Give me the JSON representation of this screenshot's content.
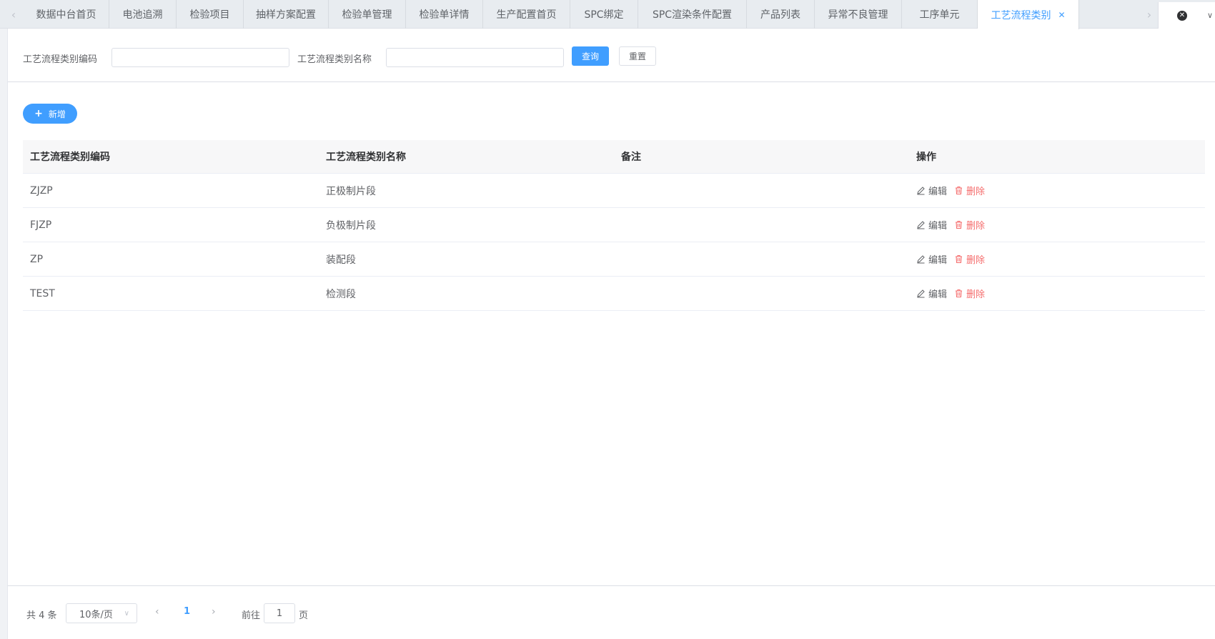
{
  "tabs": [
    {
      "label": "数据中台首页",
      "active": false
    },
    {
      "label": "电池追溯",
      "active": false
    },
    {
      "label": "检验项目",
      "active": false
    },
    {
      "label": "抽样方案配置",
      "active": false
    },
    {
      "label": "检验单管理",
      "active": false
    },
    {
      "label": "检验单详情",
      "active": false
    },
    {
      "label": "生产配置首页",
      "active": false
    },
    {
      "label": "SPC绑定",
      "active": false
    },
    {
      "label": "SPC渲染条件配置",
      "active": false
    },
    {
      "label": "产品列表",
      "active": false
    },
    {
      "label": "异常不良管理",
      "active": false
    },
    {
      "label": "工序单元",
      "active": false
    },
    {
      "label": "工艺流程类别",
      "active": true
    }
  ],
  "search": {
    "code_label": "工艺流程类别编码",
    "code_value": "",
    "name_label": "工艺流程类别名称",
    "name_value": "",
    "query_button": "查询",
    "reset_button": "重置"
  },
  "toolbar": {
    "add_button": "新增"
  },
  "table": {
    "columns": [
      "工艺流程类别编码",
      "工艺流程类别名称",
      "备注",
      "操作"
    ],
    "rows": [
      {
        "code": "ZJZP",
        "name": "正极制片段",
        "remark": ""
      },
      {
        "code": "FJZP",
        "name": "负极制片段",
        "remark": ""
      },
      {
        "code": "ZP",
        "name": "装配段",
        "remark": ""
      },
      {
        "code": "TEST",
        "name": "检测段",
        "remark": ""
      }
    ],
    "edit_label": "编辑",
    "delete_label": "删除"
  },
  "pagination": {
    "total_text": "共 4 条",
    "page_size": "10条/页",
    "current_page": "1",
    "goto_label": "前往",
    "goto_value": "1",
    "page_suffix": "页"
  },
  "colors": {
    "primary": "#409eff",
    "danger": "#f56c6c"
  }
}
